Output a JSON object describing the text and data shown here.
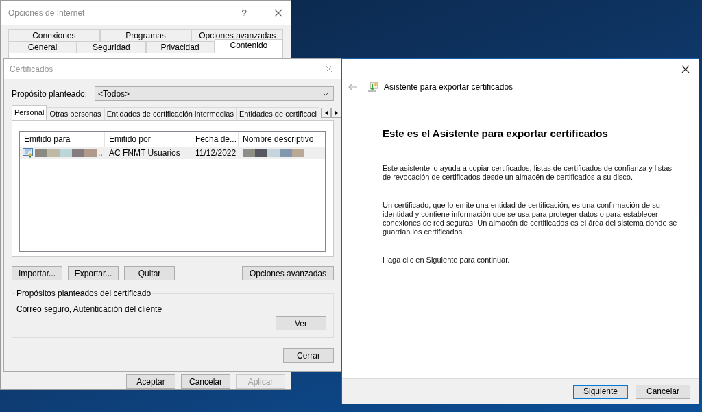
{
  "internet_options": {
    "title": "Opciones de Internet",
    "help": "?",
    "tab_rows": [
      [
        {
          "label": "Conexiones",
          "selected": false
        },
        {
          "label": "Programas",
          "selected": false
        },
        {
          "label": "Opciones avanzadas",
          "selected": false
        }
      ],
      [
        {
          "label": "General",
          "selected": false
        },
        {
          "label": "Seguridad",
          "selected": false
        },
        {
          "label": "Privacidad",
          "selected": false
        },
        {
          "label": "Contenido",
          "selected": true
        }
      ]
    ],
    "buttons": [
      {
        "label": "Aceptar",
        "disabled": false
      },
      {
        "label": "Cancelar",
        "disabled": false
      },
      {
        "label": "Aplicar",
        "disabled": true
      }
    ]
  },
  "certificates": {
    "title": "Certificados",
    "purpose_label": "Propósito planteado:",
    "purpose_value": "<Todos>",
    "tabs": [
      {
        "label": "Personal",
        "selected": true
      },
      {
        "label": "Otras personas",
        "selected": false
      },
      {
        "label": "Entidades de certificación intermedias",
        "selected": false
      },
      {
        "label": "Entidades de certificaci",
        "selected": false
      }
    ],
    "columns": [
      "Emitido para",
      "Emitido por",
      "Fecha de...",
      "Nombre descriptivo"
    ],
    "rows": [
      {
        "issued_to_suffix": "..",
        "issued_by": "AC FNMT Usuarios",
        "date": "11/12/2022",
        "selected": true
      }
    ],
    "buttons": [
      "Importar...",
      "Exportar...",
      "Quitar"
    ],
    "advanced_button": "Opciones avanzadas",
    "group_title": "Propósitos planteados del certificado",
    "group_text": "Correo seguro, Autenticación del cliente",
    "view_button": "Ver",
    "close_button": "Cerrar"
  },
  "wizard": {
    "title": "Asistente para exportar certificados",
    "heading": "Este es el Asistente para exportar certificados",
    "paragraphs": [
      "Este asistente lo ayuda a copiar certificados, listas de certificados de confianza y listas de revocación de certificados desde un almacén de certificados a su disco.",
      "Un certificado, que lo emite una entidad de certificación, es una confirmación de su identidad y contiene información que se usa para proteger datos o para establecer conexiones de red seguras. Un almacén de certificados es el área del sistema donde se guardan los certificados.",
      "Haga clic en Siguiente para continuar."
    ],
    "buttons": [
      {
        "label": "Siguiente",
        "default": true
      },
      {
        "label": "Cancelar",
        "default": false
      }
    ]
  }
}
